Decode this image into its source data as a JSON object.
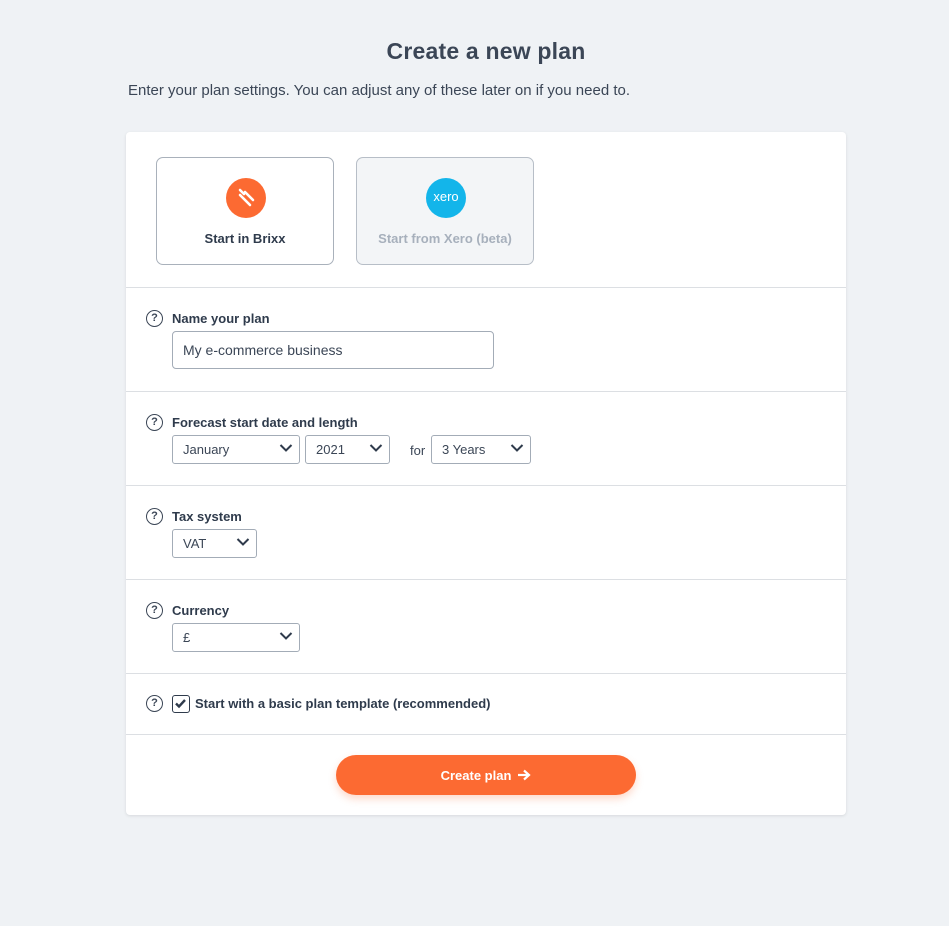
{
  "page": {
    "title": "Create a new plan",
    "subtitle": "Enter your plan settings. You can adjust any of these later on if you need to."
  },
  "sources": [
    {
      "label": "Start in Brixx",
      "icon": "brixx-logo-icon",
      "selected": true
    },
    {
      "label": "Start from Xero (beta)",
      "icon": "xero-logo-icon",
      "logo_text": "xero",
      "disabled": true
    }
  ],
  "name_section": {
    "label": "Name your plan",
    "value": "My e-commerce business"
  },
  "forecast_section": {
    "label": "Forecast start date and length",
    "month": "January",
    "year": "2021",
    "for_text": "for",
    "length": "3 Years"
  },
  "tax_section": {
    "label": "Tax system",
    "value": "VAT"
  },
  "currency_section": {
    "label": "Currency",
    "value": "£"
  },
  "template_section": {
    "label": "Start with a basic plan template (recommended)",
    "checked": true
  },
  "actions": {
    "create_label": "Create plan"
  },
  "help_glyph": "?",
  "colors": {
    "accent": "#fc6a32",
    "xero": "#13b5ea",
    "background": "#eff2f5",
    "text": "#2f3b4c"
  }
}
